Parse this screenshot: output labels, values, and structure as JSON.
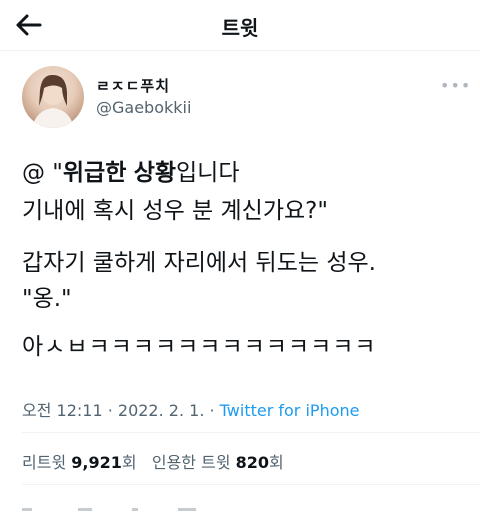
{
  "header": {
    "title": "트윗"
  },
  "author": {
    "display_name": "ㄹㅈㄷ푸치",
    "handle": "@Gaebokkii"
  },
  "tweet": {
    "line1_prefix": "@ \"",
    "line1_bold_a": "위급한",
    "line1_space": " ",
    "line1_bold_b": "상황",
    "line1_suffix": "입니다",
    "line2": "기내에 혹시 성우 분 계신가요?\"",
    "line3": "갑자기 쿨하게 자리에서 뒤도는 성우.",
    "line4": "\"옹.\"",
    "line5": "아ㅅㅂㅋㅋㅋㅋㅋㅋㅋㅋㅋㅋㅋㅋㅋ"
  },
  "meta": {
    "time_date": "오전 12:11 · 2022. 2. 1. · ",
    "source": "Twitter for iPhone"
  },
  "stats": {
    "retweets_label": "리트윗 ",
    "retweets_count": "9,921",
    "retweets_unit": "회",
    "quotes_label": "인용한 트윗 ",
    "quotes_count": "820",
    "quotes_unit": "회"
  }
}
